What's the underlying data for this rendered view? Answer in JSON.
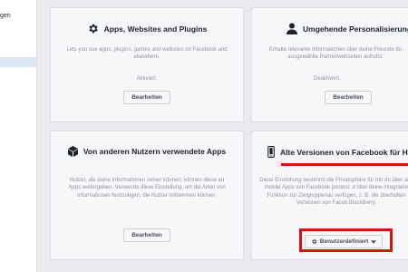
{
  "sidebar": {
    "item_text": "gen"
  },
  "cards": {
    "apps": {
      "title": "Apps, Websites and Plugins",
      "description": "Lets you use apps, plugins, games and websites on Facebook and elsewhere.",
      "status": "Aktiviert.",
      "button": "Bearbeiten",
      "icon": "gear-icon"
    },
    "personalization": {
      "title": "Umgehende Personalisierung",
      "description": "Erhalte relevante Informationen über deine Freunde du ausgewählte Partnerwebseiten aufrufst.",
      "status": "Deaktiviert.",
      "button": "Bearbeiten",
      "icon": "person-icon"
    },
    "others_apps": {
      "title": "Von anderen Nutzern verwendete Apps",
      "description": "Nutzer, die deine Informationen sehen können, können diese an Apps weitergeben. Verwende diese Einstellung, um die Arten von Informationen festzulegen, die Nutzer mitnehmen können.",
      "button": "Bearbeiten",
      "icon": "cube-icon"
    },
    "old_versions": {
      "title": "Alte Versionen von Facebook für Ha",
      "description": "Diese Einstellung bestimmt die Privatsphäre für Inh du über alte mobile Apps von Facebook postest, d über deine integrierte Funktion zur Zielgruppenau verfügen, z. B. die überholten Versionen von Faceb BlackBerry.",
      "button": "Benutzerdefiniert",
      "icon": "phone-icon"
    }
  },
  "colors": {
    "highlight": "#d0160e",
    "card_bg": "#f6f7f9",
    "page_bg": "#e9ebee"
  }
}
